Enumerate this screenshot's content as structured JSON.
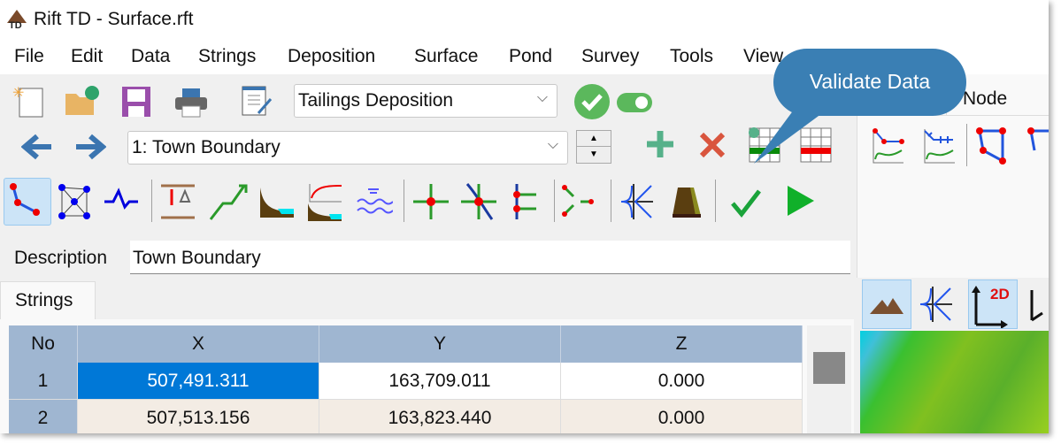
{
  "window": {
    "title": "Rift TD - Surface.rft",
    "logo_text": "TD"
  },
  "menu": [
    "File",
    "Edit",
    "Data",
    "Strings",
    "Deposition",
    "Surface",
    "Pond",
    "Survey",
    "Tools",
    "View"
  ],
  "toolbar": {
    "mode_select": "Tailings Deposition",
    "string_select": "1: Town Boundary",
    "status_color": "#5bb85c"
  },
  "description": {
    "label": "Description",
    "value": "Town Boundary"
  },
  "tabs": {
    "strings": "Strings",
    "node": "Node"
  },
  "table": {
    "headers": [
      "No",
      "X",
      "Y",
      "Z"
    ],
    "rows": [
      [
        "1",
        "507,491.311",
        "163,709.011",
        "0.000"
      ],
      [
        "2",
        "507,513.156",
        "163,823.440",
        "0.000"
      ]
    ]
  },
  "right_panel": {
    "view_2d_label": "2D"
  },
  "callout": {
    "text": "Validate Data",
    "color": "#3a7fb4"
  }
}
